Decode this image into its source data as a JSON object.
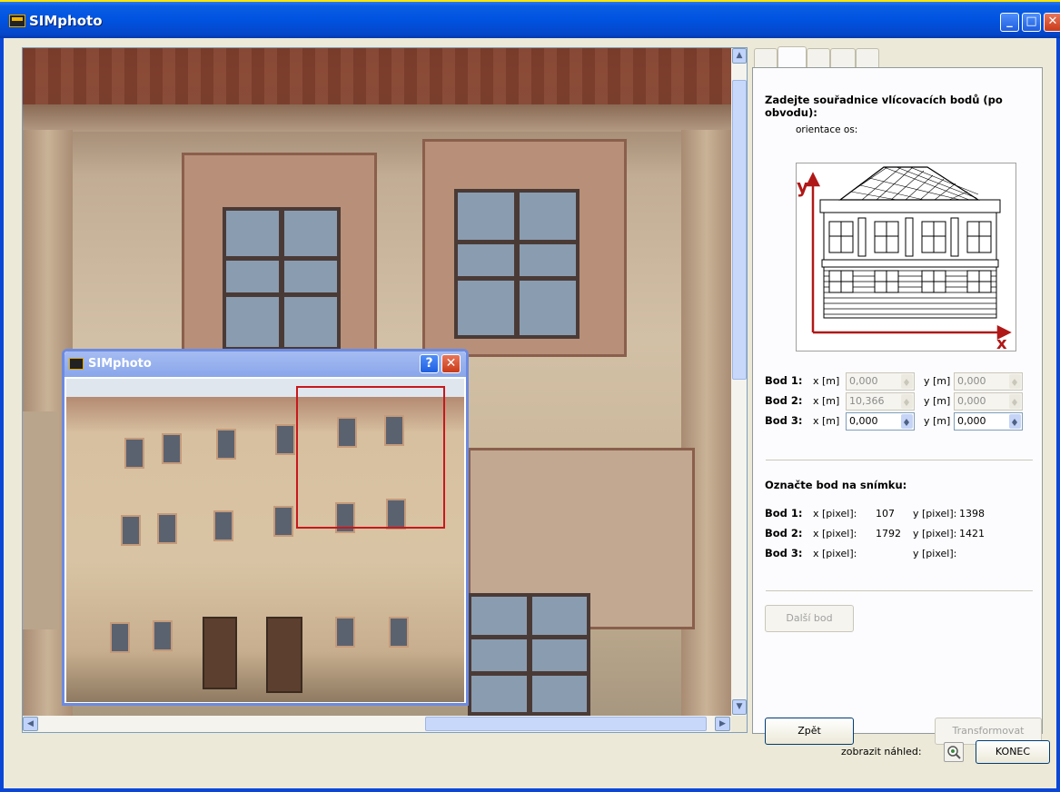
{
  "window": {
    "title": "SIMphoto",
    "controls": {
      "minimize": "_",
      "maximize": "□",
      "close": "✕"
    }
  },
  "preview_window": {
    "title": "SIMphoto",
    "help_label": "?",
    "close_label": "✕"
  },
  "panel": {
    "tabs_count": 5,
    "heading_coords": "Zadejte souřadnice vlícovacích bodů (po obvodu):",
    "axis_orientation_label": "orientace os:",
    "axis_y": "y",
    "axis_x": "x",
    "coord_rows": [
      {
        "label": "Bod 1:",
        "x_unit": "x [m]",
        "x_value": "0,000",
        "y_unit": "y [m]",
        "y_value": "0,000",
        "enabled": false
      },
      {
        "label": "Bod 2:",
        "x_unit": "x [m]",
        "x_value": "10,366",
        "y_unit": "y [m]",
        "y_value": "0,000",
        "enabled": false
      },
      {
        "label": "Bod 3:",
        "x_unit": "x [m]",
        "x_value": "0,000",
        "y_unit": "y [m]",
        "y_value": "0,000",
        "enabled": true
      }
    ],
    "heading_mark": "Označte bod na snímku:",
    "pixel_rows": [
      {
        "label": "Bod 1:",
        "x_label": "x [pixel]:",
        "x_value": "107",
        "y_label": "y [pixel]:",
        "y_value": "1398"
      },
      {
        "label": "Bod 2:",
        "x_label": "x [pixel]:",
        "x_value": "1792",
        "y_label": "y [pixel]:",
        "y_value": "1421"
      },
      {
        "label": "Bod 3:",
        "x_label": "x [pixel]:",
        "x_value": "",
        "y_label": "y [pixel]:",
        "y_value": ""
      }
    ],
    "next_point_button": "Další bod",
    "back_button": "Zpět",
    "transform_button": "Transformovat"
  },
  "footer": {
    "preview_label": "zobrazit náhled:",
    "end_button": "KONEC"
  },
  "colors": {
    "titlebar": "#0053e0",
    "accent_red": "#c8181c",
    "axis_red": "#b01818"
  }
}
